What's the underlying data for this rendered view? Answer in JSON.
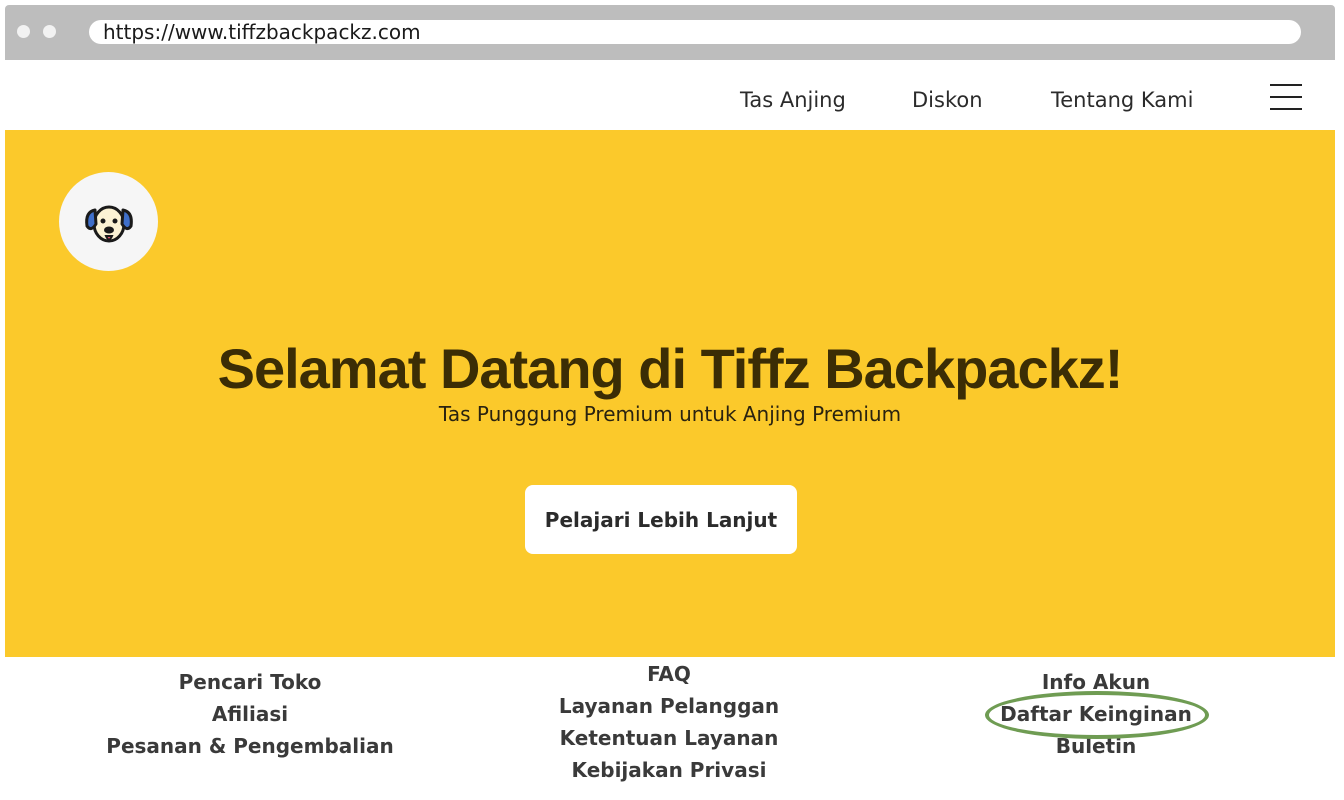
{
  "browser": {
    "url": "https://www.tiffzbackpackz.com"
  },
  "nav": {
    "links": [
      "Tas Anjing",
      "Diskon",
      "Tentang Kami"
    ],
    "menu_icon": "hamburger-menu-icon"
  },
  "hero": {
    "logo_icon": "dog-face-icon",
    "title": "Selamat Datang di Tiffz Backpackz!",
    "subtitle": "Tas Punggung Premium untuk Anjing Premium",
    "cta_label": "Pelajari Lebih Lanjut",
    "background_color": "#fbc92b"
  },
  "footer": {
    "col1": [
      "Pencari Toko",
      "Afiliasi",
      "Pesanan & Pengembalian"
    ],
    "col2": [
      "FAQ",
      "Layanan Pelanggan",
      "Ketentuan Layanan",
      "Kebijakan Privasi"
    ],
    "col3": [
      "Info Akun",
      "Daftar Keinginan",
      "Buletin"
    ],
    "highlighted_item": "Daftar Keinginan",
    "highlight_color": "#6f9c53"
  }
}
